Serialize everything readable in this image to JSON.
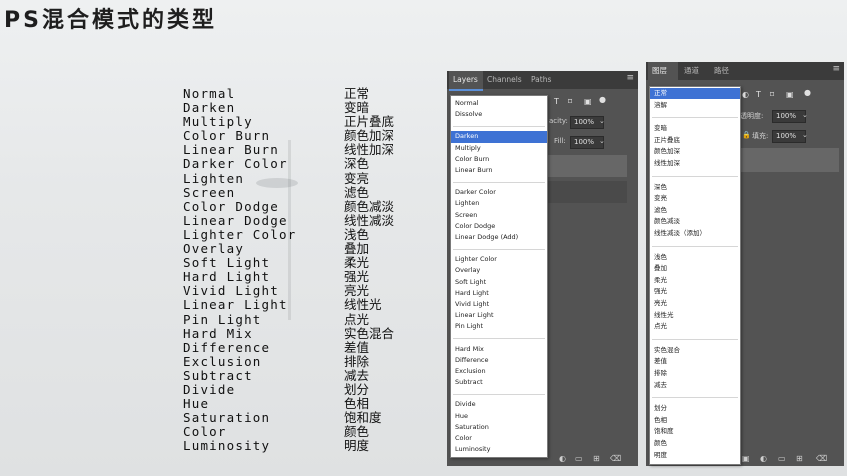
{
  "title": "PS混合模式的类型",
  "modes_en": [
    "Normal",
    "Darken",
    "Multiply",
    "Color Burn",
    "Linear Burn",
    "Darker Color",
    "Lighten",
    "Screen",
    "Color Dodge",
    "Linear Dodge",
    "Lighter Color",
    "Overlay",
    "Soft Light",
    "Hard Light",
    "Vivid Light",
    "Linear Light",
    "Pin Light",
    "Hard Mix",
    "Difference",
    "Exclusion",
    "Subtract",
    "Divide",
    "Hue",
    "Saturation",
    "Color",
    "Luminosity"
  ],
  "modes_zh": [
    "正常",
    "变暗",
    "正片叠底",
    "颜色加深",
    "线性加深",
    "深色",
    "变亮",
    "滤色",
    "颜色减淡",
    "线性减淡",
    "浅色",
    "叠加",
    "柔光",
    "强光",
    "亮光",
    "线性光",
    "点光",
    "实色混合",
    "差值",
    "排除",
    "减去",
    "划分",
    "色相",
    "饱和度",
    "颜色",
    "明度"
  ],
  "panel_en": {
    "tabs": [
      "Layers",
      "Channels",
      "Paths"
    ],
    "opacity_label": "acity:",
    "opacity_value": "100%",
    "fill_label": "Fill:",
    "fill_value": "100%",
    "menu_icon": "≡",
    "dropdown_items": [
      "Normal",
      "Dissolve",
      "Darken",
      "Multiply",
      "Color Burn",
      "Linear Burn",
      "Darker Color",
      "Lighten",
      "Screen",
      "Color Dodge",
      "Linear Dodge (Add)",
      "Lighter Color",
      "Overlay",
      "Soft Light",
      "Hard Light",
      "Vivid Light",
      "Linear Light",
      "Pin Light",
      "Hard Mix",
      "Difference",
      "Exclusion",
      "Subtract",
      "Divide",
      "Hue",
      "Saturation",
      "Color",
      "Luminosity"
    ],
    "selected": "Darken"
  },
  "panel_zh": {
    "tabs": [
      "图层",
      "通道",
      "路径"
    ],
    "opacity_label": "透明度:",
    "opacity_value": "100%",
    "fill_label": "填充:",
    "fill_value": "100%",
    "menu_icon": "≡",
    "dropdown_items": [
      "正常",
      "溶解",
      "变暗",
      "正片叠底",
      "颜色加深",
      "线性加深",
      "深色",
      "变亮",
      "滤色",
      "颜色减淡",
      "线性减淡（添加）",
      "浅色",
      "叠加",
      "柔光",
      "强光",
      "亮光",
      "线性光",
      "点光",
      "实色混合",
      "差值",
      "排除",
      "减去",
      "划分",
      "色相",
      "饱和度",
      "颜色",
      "明度"
    ],
    "selected": "正常"
  },
  "colors": {
    "selection": "#3e72d4",
    "panel_bg": "#535353",
    "tab_bg": "#3b3b3b"
  }
}
